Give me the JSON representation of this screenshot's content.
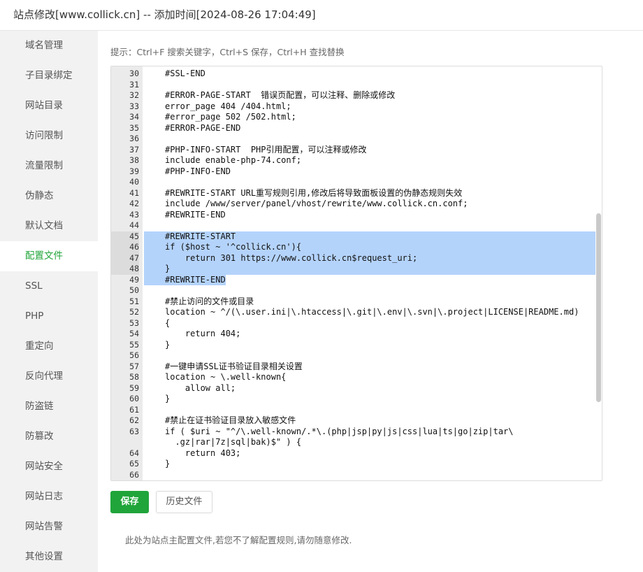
{
  "window": {
    "title": "站点修改[www.collick.cn] -- 添加时间[2024-08-26 17:04:49]"
  },
  "sidebar": {
    "active": "配置文件",
    "items": [
      {
        "label": "域名管理"
      },
      {
        "label": "子目录绑定"
      },
      {
        "label": "网站目录"
      },
      {
        "label": "访问限制"
      },
      {
        "label": "流量限制"
      },
      {
        "label": "伪静态"
      },
      {
        "label": "默认文档"
      },
      {
        "label": "配置文件"
      },
      {
        "label": "SSL"
      },
      {
        "label": "PHP"
      },
      {
        "label": "重定向"
      },
      {
        "label": "反向代理"
      },
      {
        "label": "防盗链"
      },
      {
        "label": "防篡改"
      },
      {
        "label": "网站安全"
      },
      {
        "label": "网站日志"
      },
      {
        "label": "网站告警"
      },
      {
        "label": "其他设置"
      }
    ]
  },
  "main": {
    "tip": "提示：Ctrl+F 搜索关键字，Ctrl+S 保存，Ctrl+H 查找替换",
    "save_label": "保存",
    "history_label": "历史文件",
    "note": "此处为站点主配置文件,若您不了解配置规则,请勿随意修改."
  },
  "editor": {
    "lines": [
      {
        "num": "30",
        "text": "#SSL-END"
      },
      {
        "num": "31",
        "text": ""
      },
      {
        "num": "32",
        "text": "#ERROR-PAGE-START  错误页配置，可以注释、删除或修改"
      },
      {
        "num": "33",
        "text": "error_page 404 /404.html;"
      },
      {
        "num": "34",
        "text": "#error_page 502 /502.html;"
      },
      {
        "num": "35",
        "text": "#ERROR-PAGE-END"
      },
      {
        "num": "36",
        "text": ""
      },
      {
        "num": "37",
        "text": "#PHP-INFO-START  PHP引用配置，可以注释或修改"
      },
      {
        "num": "38",
        "text": "include enable-php-74.conf;"
      },
      {
        "num": "39",
        "text": "#PHP-INFO-END"
      },
      {
        "num": "40",
        "text": ""
      },
      {
        "num": "41",
        "text": "#REWRITE-START URL重写规则引用,修改后将导致面板设置的伪静态规则失效"
      },
      {
        "num": "42",
        "text": "include /www/server/panel/vhost/rewrite/www.collick.cn.conf;"
      },
      {
        "num": "43",
        "text": "#REWRITE-END"
      },
      {
        "num": "44",
        "text": ""
      },
      {
        "num": "45",
        "text": "#REWRITE-START"
      },
      {
        "num": "46",
        "text": "if ($host ~ '^collick.cn'){"
      },
      {
        "num": "47",
        "text": "    return 301 https://www.collick.cn$request_uri;"
      },
      {
        "num": "48",
        "text": "}"
      },
      {
        "num": "49",
        "text": "#REWRITE-END"
      },
      {
        "num": "50",
        "text": ""
      },
      {
        "num": "51",
        "text": "#禁止访问的文件或目录"
      },
      {
        "num": "52",
        "text": "location ~ ^/(\\.user.ini|\\.htaccess|\\.git|\\.env|\\.svn|\\.project|LICENSE|README.md)"
      },
      {
        "num": "53",
        "text": "{"
      },
      {
        "num": "54",
        "text": "    return 404;"
      },
      {
        "num": "55",
        "text": "}"
      },
      {
        "num": "56",
        "text": ""
      },
      {
        "num": "57",
        "text": "#一键申请SSL证书验证目录相关设置"
      },
      {
        "num": "58",
        "text": "location ~ \\.well-known{"
      },
      {
        "num": "59",
        "text": "    allow all;"
      },
      {
        "num": "60",
        "text": "}"
      },
      {
        "num": "61",
        "text": ""
      },
      {
        "num": "62",
        "text": "#禁止在证书验证目录放入敏感文件"
      },
      {
        "num": "63",
        "text": "if ( $uri ~ \"^/\\.well-known/.*\\.(php|jsp|py|js|css|lua|ts|go|zip|tar\\"
      },
      {
        "num": "",
        "text": "  .gz|rar|7z|sql|bak)$\" ) {"
      },
      {
        "num": "64",
        "text": "    return 403;"
      },
      {
        "num": "65",
        "text": "}"
      },
      {
        "num": "66",
        "text": ""
      }
    ]
  }
}
